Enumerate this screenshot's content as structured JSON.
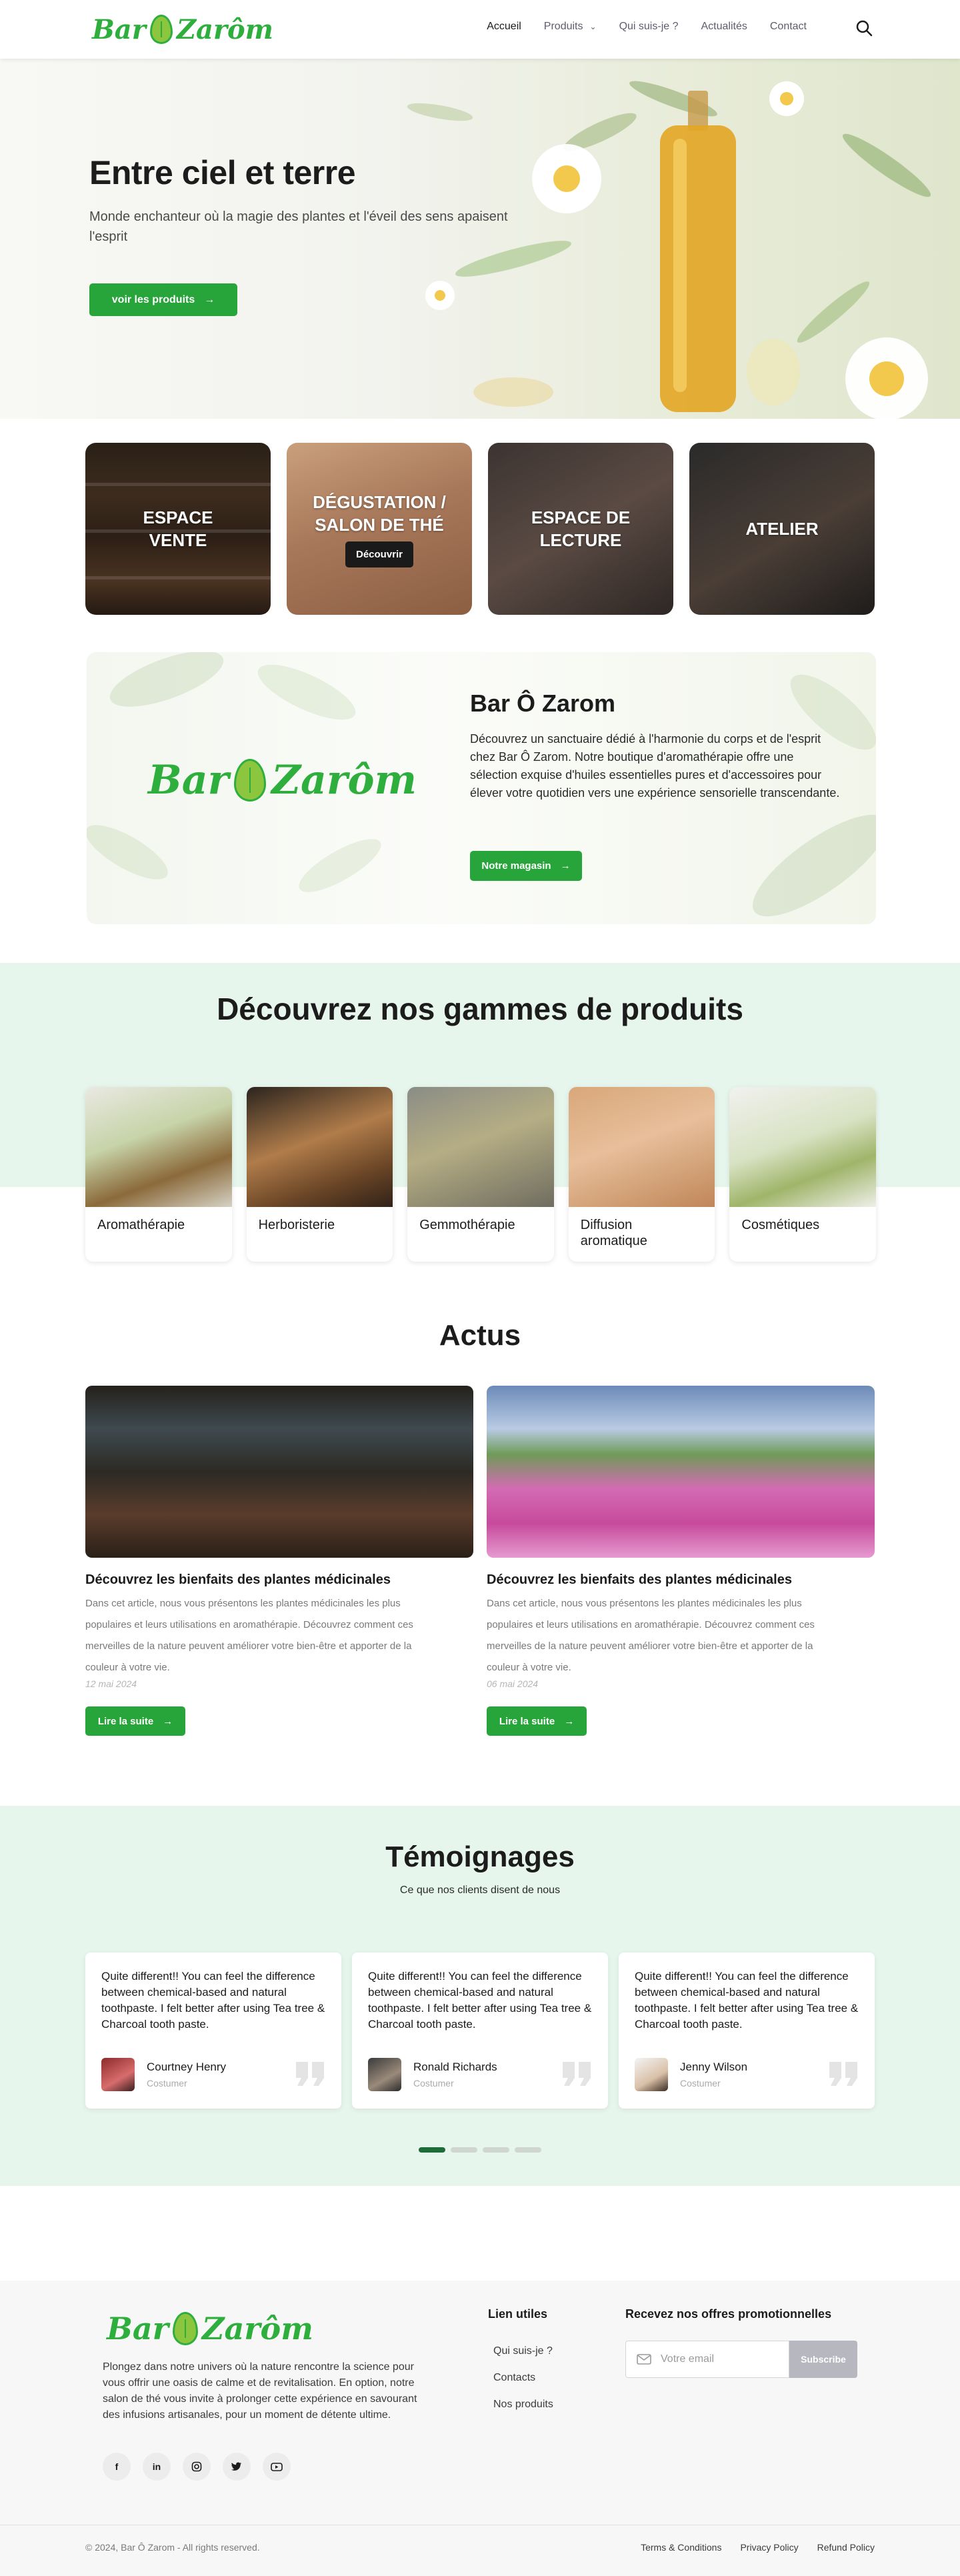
{
  "brand": {
    "name": "Bar Ô Zarôm",
    "color": "#27a53a"
  },
  "nav": {
    "home": "Accueil",
    "products": "Produits",
    "about": "Qui suis-je ?",
    "news": "Actualités",
    "contact": "Contact"
  },
  "hero": {
    "title": "Entre ciel et terre",
    "subtitle": "Monde enchanteur où la magie des plantes et l'éveil des sens apaisent l'esprit",
    "cta": "voir les produits"
  },
  "spaces": [
    {
      "title": "ESPACE VENTE",
      "button": ""
    },
    {
      "title": "DÉGUSTATION / SALON DE THÉ",
      "button": "Découvrir"
    },
    {
      "title": "ESPACE DE LECTURE",
      "button": ""
    },
    {
      "title": "ATELIER",
      "button": ""
    }
  ],
  "about": {
    "title": "Bar Ô Zarom",
    "text": "Découvrez un sanctuaire dédié à l'harmonie du corps et de l'esprit chez Bar Ô Zarom. Notre boutique d'aromathérapie offre une sélection exquise d'huiles essentielles pures et d'accessoires pour élever votre quotidien vers une expérience sensorielle transcendante.",
    "cta": "Notre magasin"
  },
  "gammes": {
    "title": "Découvrez nos gammes de produits",
    "items": [
      "Aromathérapie",
      "Herboristerie",
      "Gemmothérapie",
      "Diffusion aromatique",
      "Cosmétiques"
    ]
  },
  "actus": {
    "title": "Actus",
    "articles": [
      {
        "title": "Découvrez les bienfaits des plantes médicinales",
        "excerpt": "Dans cet article, nous vous présentons les plantes médicinales les plus populaires et leurs utilisations en aromathérapie. Découvrez comment ces merveilles de la nature peuvent améliorer votre bien-être et apporter de la couleur à votre vie.",
        "date": "12 mai 2024",
        "cta": "Lire la suite"
      },
      {
        "title": "Découvrez les bienfaits des plantes médicinales",
        "excerpt": "Dans cet article, nous vous présentons les plantes médicinales les plus populaires et leurs utilisations en aromathérapie. Découvrez comment ces merveilles de la nature peuvent améliorer votre bien-être et apporter de la couleur à votre vie.",
        "date": "06 mai 2024",
        "cta": "Lire la suite"
      }
    ]
  },
  "testimonials": {
    "title": "Témoignages",
    "subtitle": "Ce que nos clients disent de nous",
    "items": [
      {
        "quote": "Quite different!! You can feel the difference between chemical-based and natural toothpaste. I felt better after using Tea tree & Charcoal tooth paste.",
        "name": "Courtney Henry",
        "role": "Costumer"
      },
      {
        "quote": "Quite different!! You can feel the difference between chemical-based and natural toothpaste. I felt better after using Tea tree & Charcoal tooth paste.",
        "name": "Ronald Richards",
        "role": "Costumer"
      },
      {
        "quote": "Quite different!! You can feel the difference between chemical-based and natural toothpaste. I felt better after using Tea tree & Charcoal tooth paste.",
        "name": "Jenny Wilson",
        "role": "Costumer"
      }
    ],
    "active_page": 1,
    "pages": 4
  },
  "footer": {
    "text": "Plongez dans notre univers où la nature rencontre la science pour vous offrir une oasis de calme et de revitalisation. En option, notre salon de thé vous invite à prolonger cette expérience en savourant des infusions artisanales, pour un moment de détente ultime.",
    "socials": [
      "f",
      "in",
      "ig",
      "tw",
      "yt"
    ],
    "links_title": "Lien utiles",
    "links": [
      "Qui suis-je ?",
      "Contacts",
      "Nos produits"
    ],
    "newsletter_title": "Recevez nos offres promotionnelles",
    "email_placeholder": "Votre email",
    "subscribe": "Subscribe",
    "copyright": "© 2024, Bar Ô Zarom - All rights reserved.",
    "legal": [
      "Terms & Conditions",
      "Privacy Policy",
      "Refund Policy"
    ]
  }
}
